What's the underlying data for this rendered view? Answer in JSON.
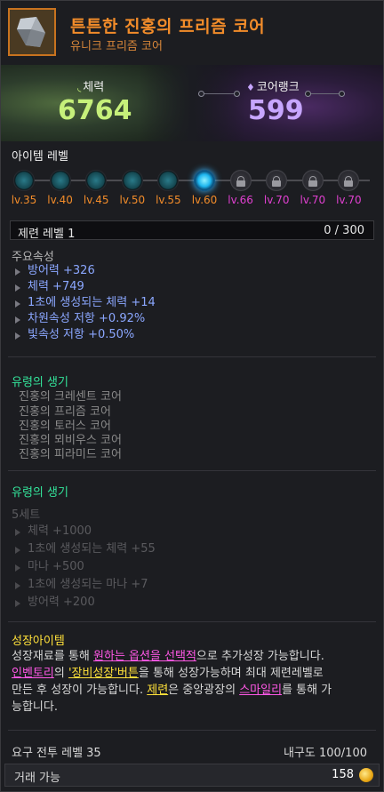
{
  "item": {
    "name": "튼튼한 진홍의 프리즘 코어",
    "grade": "유니크 프리즘 코어"
  },
  "stats": {
    "hp_label": "체력",
    "hp_value": "6764",
    "core_label": "코어랭크",
    "core_value": "599"
  },
  "item_level": {
    "title": "아이템 레벨",
    "nodes": [
      {
        "label": "lv.35",
        "state": "on",
        "color": "#f28c2a"
      },
      {
        "label": "lv.40",
        "state": "on",
        "color": "#f28c2a"
      },
      {
        "label": "lv.45",
        "state": "on",
        "color": "#f28c2a"
      },
      {
        "label": "lv.50",
        "state": "on",
        "color": "#f28c2a"
      },
      {
        "label": "lv.55",
        "state": "on",
        "color": "#f28c2a"
      },
      {
        "label": "lv.60",
        "state": "current",
        "color": "#f28c2a"
      },
      {
        "label": "lv.66",
        "state": "locked",
        "color": "#e040d0"
      },
      {
        "label": "lv.70",
        "state": "locked",
        "color": "#e040d0"
      },
      {
        "label": "lv.70",
        "state": "locked",
        "color": "#e040d0"
      },
      {
        "label": "lv.70",
        "state": "locked",
        "color": "#e040d0"
      }
    ],
    "limit_label": "제련 레벨 1",
    "limit_value": "0 / 300"
  },
  "main_attrs": {
    "title": "주요속성",
    "items": [
      "방어력 +326",
      "체력 +749",
      "1초에 생성되는 체력 +14",
      "차원속성 저항 +0.92%",
      "빛속성 저항 +0.50%"
    ]
  },
  "ghost1": {
    "title": "유령의 생기",
    "items": [
      "진홍의 크레센트 코어",
      "진홍의 프리즘 코어",
      "진홍의 토러스 코어",
      "진홍의 뫼비우스 코어",
      "진홍의 피라미드 코어"
    ]
  },
  "ghost2": {
    "title": "유령의 생기",
    "set_label": "5세트",
    "items": [
      "체력 +1000",
      "1초에 생성되는 체력 +55",
      "마나 +500",
      "1초에 생성되는 마나 +7",
      "방어력 +200"
    ]
  },
  "growth": {
    "title": "성장아이템",
    "l1a": "성장재료를 통해 ",
    "l1b": "원하는 옵션을 선택적",
    "l1c": "으로 추가성장 가능합니다.",
    "l2a": "인벤토리",
    "l2b": "의 ",
    "l2c": "'장비성장'버튼",
    "l2d": "을 통해 성장가능하며 최대 제련레벨로",
    "l3a": "만든 후 성장이 가능합니다. ",
    "l3b": "제련",
    "l3c": "은 중앙광장의 ",
    "l3d": "스마일리",
    "l3e": "를 통해 가",
    "l4": "능합니다."
  },
  "footer": {
    "req_level": "요구 전투 레벨 35",
    "durability": "내구도 100/100",
    "trade": "거래 가능",
    "price": "158"
  }
}
